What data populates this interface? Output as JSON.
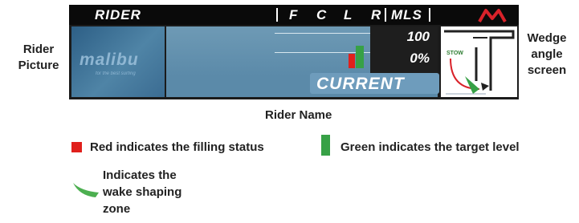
{
  "screen": {
    "header": {
      "rider": "RIDER",
      "cols": [
        "F",
        "C",
        "L",
        "R"
      ],
      "mls": "MLS"
    },
    "logo_text": "malibu",
    "logo_tagline": "for the best surfing",
    "readout_top": "100",
    "readout_bottom": "0%",
    "current_label": "CURRENT",
    "wedge_label": "STOW",
    "colors": {
      "fill": "#e0201c",
      "target": "#37a146"
    }
  },
  "labels": {
    "rider_picture": [
      "Rider",
      "Picture"
    ],
    "wedge_angle_screen": [
      "Wedge",
      "angle",
      "screen"
    ],
    "rider_name": "Rider Name"
  },
  "legend": {
    "red": "Red indicates the filling status",
    "green": "Green indicates the target level",
    "wake": [
      "Indicates the",
      "wake shaping",
      "zone"
    ]
  }
}
